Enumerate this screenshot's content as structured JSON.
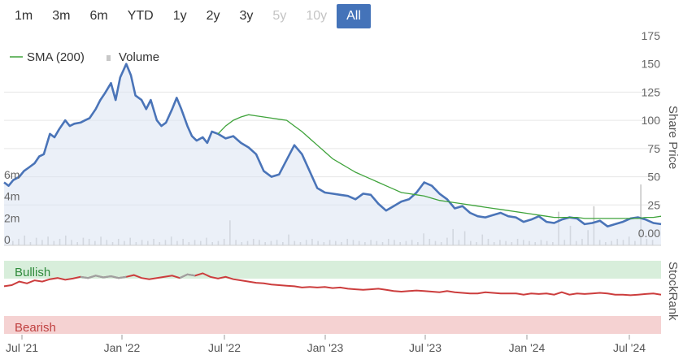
{
  "range_selector": {
    "buttons": [
      {
        "label": "1m",
        "state": "normal"
      },
      {
        "label": "3m",
        "state": "normal"
      },
      {
        "label": "6m",
        "state": "normal"
      },
      {
        "label": "YTD",
        "state": "normal"
      },
      {
        "label": "1y",
        "state": "normal"
      },
      {
        "label": "2y",
        "state": "normal"
      },
      {
        "label": "3y",
        "state": "normal"
      },
      {
        "label": "5y",
        "state": "disabled"
      },
      {
        "label": "10y",
        "state": "disabled"
      },
      {
        "label": "All",
        "state": "active"
      }
    ]
  },
  "legend": {
    "sma_label": "SMA (200)",
    "volume_label": "Volume"
  },
  "colors": {
    "price": "#4a74b8",
    "sma": "#3fa33b",
    "volume": "#c8c8c8",
    "bullish_bg": "#d8eedb",
    "bearish_bg": "#f5d2d2",
    "rank_line": "#cc3d3d",
    "rank_grey": "#a0a0a0",
    "accent": "#4473b9"
  },
  "chart_data": {
    "type": "line",
    "x_ticks": [
      "Jul '21",
      "Jan '22",
      "Jul '22",
      "Jan '23",
      "Jul '23",
      "Jan '24",
      "Jul '24"
    ],
    "price_axis": {
      "label": "Share Price",
      "ticks": [
        "175",
        "150",
        "125",
        "100",
        "75",
        "50",
        "25",
        "0.00"
      ],
      "ylim": [
        0,
        175
      ]
    },
    "volume_axis": {
      "ticks": [
        "6m",
        "4m",
        "2m",
        "0"
      ],
      "ylim": [
        0,
        8
      ]
    },
    "price_series": {
      "t": [
        0,
        0.3,
        0.6,
        1,
        1.3,
        1.6,
        2,
        2.3,
        2.6,
        3,
        3.3,
        3.6,
        4,
        4.3,
        4.6,
        5,
        5.3,
        5.6,
        6,
        6.3,
        6.6,
        7,
        7.3,
        7.6,
        8,
        8.3,
        8.6,
        9,
        9.3,
        9.6,
        10,
        10.3,
        10.6,
        11,
        11.3,
        11.6,
        12,
        12.3,
        12.6,
        13,
        13.3,
        13.6,
        14,
        14.5,
        15,
        15.5,
        16,
        16.5,
        17,
        17.5,
        18,
        18.5,
        19,
        19.5,
        20,
        20.5,
        21,
        21.5,
        22,
        22.5,
        23,
        23.5,
        24,
        24.5,
        25,
        25.5,
        26,
        26.5,
        27,
        27.5,
        28,
        28.5,
        29,
        29.5,
        30,
        30.5,
        31,
        31.5,
        32,
        32.5,
        33,
        33.5,
        34,
        34.5,
        35,
        35.5,
        36,
        36.5,
        37,
        37.5,
        38,
        38.5,
        39,
        39.5,
        40,
        40.5,
        41,
        41.5,
        42,
        42.5,
        43
      ],
      "values": [
        45,
        42,
        47,
        50,
        55,
        58,
        62,
        68,
        70,
        88,
        85,
        92,
        100,
        95,
        97,
        98,
        100,
        102,
        110,
        118,
        124,
        133,
        118,
        138,
        150,
        140,
        122,
        118,
        110,
        118,
        100,
        95,
        98,
        110,
        120,
        110,
        95,
        86,
        82,
        85,
        80,
        90,
        88,
        84,
        86,
        80,
        76,
        70,
        55,
        50,
        52,
        65,
        78,
        70,
        55,
        40,
        36,
        35,
        34,
        33,
        30,
        35,
        34,
        26,
        20,
        24,
        28,
        30,
        36,
        45,
        42,
        35,
        30,
        22,
        24,
        18,
        15,
        14,
        16,
        18,
        15,
        14,
        10,
        12,
        15,
        10,
        9,
        12,
        14,
        13,
        8,
        9,
        11,
        6,
        8,
        10,
        13,
        14,
        12,
        9,
        8,
        9,
        12
      ]
    },
    "sma_series": {
      "t": [
        14,
        14.5,
        15,
        15.5,
        16,
        16.5,
        17,
        17.5,
        18,
        18.5,
        19,
        19.5,
        20,
        20.5,
        21,
        21.5,
        22,
        22.5,
        23,
        23.5,
        24,
        24.5,
        25,
        25.5,
        26,
        26.5,
        27,
        27.5,
        28,
        28.5,
        29,
        29.5,
        30,
        30.5,
        31,
        31.5,
        32,
        32.5,
        33,
        33.5,
        34,
        34.5,
        35,
        35.5,
        36,
        36.5,
        37,
        37.5,
        38,
        38.5,
        39,
        39.5,
        40,
        40.5,
        41,
        41.5,
        42,
        42.5,
        43
      ],
      "values": [
        88,
        95,
        100,
        103,
        105,
        104,
        103,
        102,
        101,
        100,
        95,
        90,
        84,
        78,
        72,
        66,
        62,
        58,
        54,
        51,
        48,
        45,
        42,
        39,
        36,
        35,
        34,
        33,
        31,
        29,
        28,
        27,
        26,
        25,
        24,
        23,
        22,
        21,
        20,
        19,
        18,
        17,
        16,
        15,
        14,
        14,
        14,
        14,
        13,
        13,
        13,
        13,
        13,
        13,
        13,
        13,
        14,
        14,
        15
      ]
    },
    "volume_series": {
      "values": [
        0.4,
        0.6,
        0.9,
        0.3,
        0.7,
        0.5,
        0.8,
        0.4,
        0.6,
        0.9,
        0.5,
        0.3,
        0.7,
        0.6,
        0.4,
        0.8,
        0.5,
        0.3,
        0.6,
        0.4,
        0.7,
        0.3,
        0.5,
        0.4,
        0.6,
        0.3,
        0.5,
        0.8,
        0.4,
        0.6,
        0.3,
        0.5,
        0.4,
        0.7,
        0.3,
        0.4,
        0.6,
        2.3,
        0.5,
        0.3,
        0.4,
        0.6,
        0.5,
        0.3,
        0.4,
        0.5,
        0.3,
        1.0,
        0.4,
        0.3,
        0.5,
        0.6,
        0.4,
        0.3,
        0.5,
        0.4,
        0.3,
        0.6,
        0.5,
        0.4,
        0.3,
        0.5,
        0.4,
        0.3,
        0.6,
        0.5,
        0.3,
        0.4,
        0.5,
        0.3,
        1.1,
        0.6,
        0.4,
        0.3,
        0.7,
        1.5,
        0.5,
        1.3,
        0.4,
        0.3,
        1.0,
        0.6,
        0.3,
        0.5,
        0.4,
        0.3,
        0.6,
        0.5,
        0.4,
        0.3,
        0.5,
        0.4,
        0.3,
        3.1,
        0.5,
        1.8,
        0.4,
        0.6,
        1.4,
        3.6,
        0.5,
        0.3,
        0.4,
        0.6,
        0.5,
        0.8,
        0.4,
        5.6,
        0.6,
        0.5
      ]
    },
    "stockrank": {
      "label": "StockRank",
      "bullish_label": "Bullish",
      "bearish_label": "Bearish",
      "grey_segments": [
        [
          5,
          8
        ],
        [
          11.3,
          12.5
        ]
      ],
      "t": [
        0,
        0.5,
        1,
        1.5,
        2,
        2.5,
        3,
        3.5,
        4,
        4.5,
        5,
        5.5,
        6,
        6.5,
        7,
        7.5,
        8,
        8.5,
        9,
        9.5,
        10,
        10.5,
        11,
        11.5,
        12,
        12.5,
        13,
        13.5,
        14,
        14.5,
        15,
        15.5,
        16,
        16.5,
        17,
        17.5,
        18,
        18.5,
        19,
        19.5,
        20,
        20.5,
        21,
        21.5,
        22,
        22.5,
        23,
        23.5,
        24,
        24.5,
        25,
        25.5,
        26,
        26.5,
        27,
        27.5,
        28,
        28.5,
        29,
        29.5,
        30,
        30.5,
        31,
        31.5,
        32,
        32.5,
        33,
        33.5,
        34,
        34.5,
        35,
        35.5,
        36,
        36.5,
        37,
        37.5,
        38,
        38.5,
        39,
        39.5,
        40,
        40.5,
        41,
        41.5,
        42,
        42.5,
        43
      ],
      "values": [
        72,
        74,
        80,
        77,
        82,
        80,
        84,
        86,
        83,
        85,
        88,
        86,
        90,
        87,
        89,
        86,
        88,
        91,
        86,
        84,
        86,
        88,
        90,
        86,
        92,
        90,
        94,
        88,
        85,
        88,
        84,
        82,
        80,
        78,
        77,
        75,
        74,
        73,
        72,
        70,
        71,
        70,
        71,
        69,
        70,
        68,
        67,
        66,
        67,
        68,
        66,
        64,
        63,
        64,
        65,
        64,
        63,
        62,
        64,
        62,
        61,
        60,
        60,
        62,
        61,
        60,
        60,
        60,
        58,
        60,
        59,
        60,
        58,
        62,
        58,
        60,
        59,
        60,
        61,
        60,
        58,
        58,
        57,
        58,
        59,
        60,
        58
      ]
    }
  }
}
